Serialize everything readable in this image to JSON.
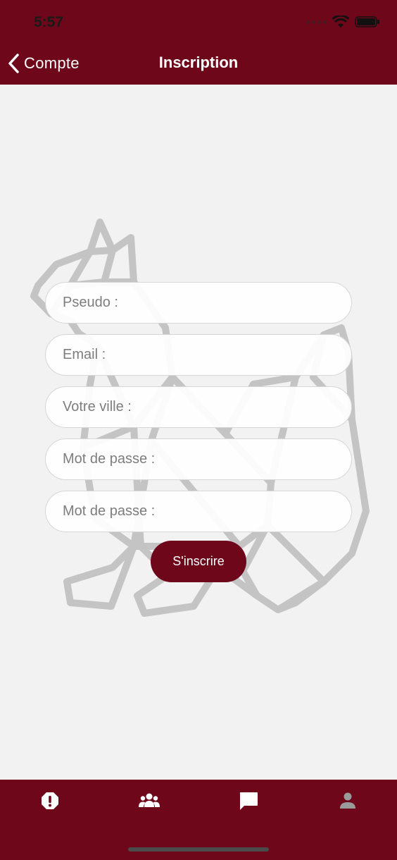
{
  "status_bar": {
    "time": "5:57",
    "icons": [
      "signal-dots-icon",
      "wifi-icon",
      "battery-icon"
    ]
  },
  "nav": {
    "back_label": "Compte",
    "title": "Inscription"
  },
  "form": {
    "fields": [
      {
        "placeholder": "Pseudo :",
        "value": ""
      },
      {
        "placeholder": "Email :",
        "value": ""
      },
      {
        "placeholder": "Votre ville :",
        "value": ""
      },
      {
        "placeholder": "Mot de passe :",
        "value": ""
      },
      {
        "placeholder": "Mot de passe :",
        "value": ""
      }
    ],
    "submit_label": "S'inscrire"
  },
  "tabbar": {
    "items": [
      {
        "icon": "alert-icon",
        "active": true
      },
      {
        "icon": "group-icon",
        "active": true
      },
      {
        "icon": "chat-icon",
        "active": true
      },
      {
        "icon": "person-icon",
        "active": false
      }
    ]
  },
  "colors": {
    "brand": "#6d0719",
    "background": "#f2f2f2",
    "inactive_tab": "#9a9a9a"
  }
}
